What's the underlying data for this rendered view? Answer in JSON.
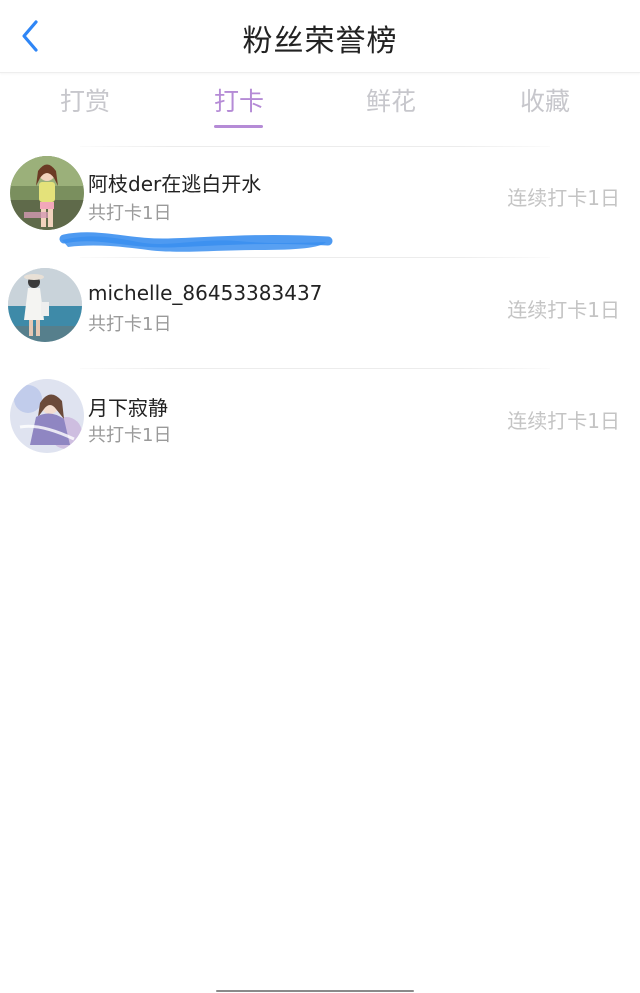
{
  "header": {
    "title": "粉丝荣誉榜",
    "back_icon": "chevron-left-icon",
    "accent_color": "#2f86f6"
  },
  "tabs": [
    {
      "label": "打赏",
      "active": false
    },
    {
      "label": "打卡",
      "active": true
    },
    {
      "label": "鲜花",
      "active": false
    },
    {
      "label": "收藏",
      "active": false
    }
  ],
  "tab_active_color": "#b58bd6",
  "list": [
    {
      "name": "阿枝der在逃白开水",
      "total": "共打卡1日",
      "streak": "连续打卡1日"
    },
    {
      "name": "michelle_86453383437",
      "total": "共打卡1日",
      "streak": "连续打卡1日"
    },
    {
      "name": "月下寂静",
      "total": "共打卡1日",
      "streak": "连续打卡1日"
    }
  ],
  "annotation": {
    "icon": "scribble-mark",
    "color": "#3b8ff0"
  }
}
